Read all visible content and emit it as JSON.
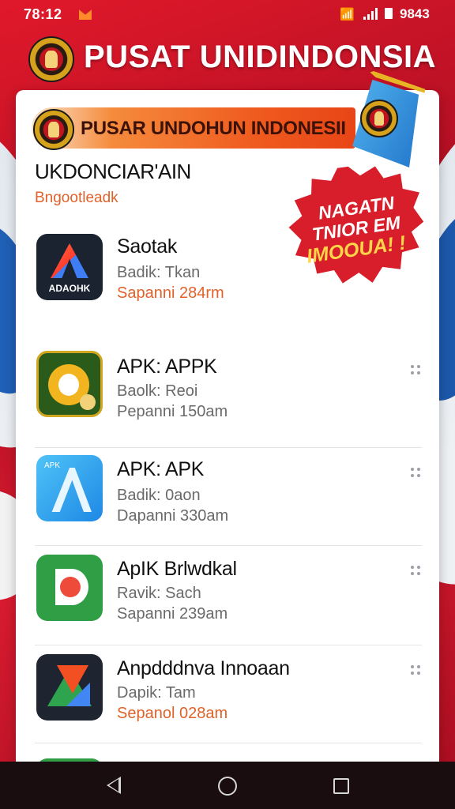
{
  "status_bar": {
    "time": "78:12",
    "battery_text": "9843",
    "icons": [
      "notification-icon",
      "wifi-icon",
      "signal-icon",
      "battery-icon"
    ]
  },
  "header": {
    "title": "PUSAT UNIDINDONSIA",
    "logo_icon": "garuda-emblem"
  },
  "banner": {
    "text": "PUSAR UNDOHUN INDONESII"
  },
  "section": {
    "title": "UKDONCIAR'AIN",
    "subtitle": "Bngootleadk"
  },
  "sticker": {
    "line1": "NAGATN",
    "line2": "TNIOR EM",
    "line3": "IMOOUA! !"
  },
  "apps": [
    {
      "name": "Saotak",
      "line1": "Badik: Tkan",
      "line2": "Sapanni 284rm",
      "icon": "dark-a-app-icon",
      "icon_label": "ADAOHK"
    },
    {
      "name": "APK: APPK",
      "line1": "Baolk: Reoi",
      "line2": "Pepanni 150am",
      "icon": "green-ring-app-icon"
    },
    {
      "name": "APK: APK",
      "line1": "Badik: 0aon",
      "line2": "Dapanni 330am",
      "icon": "blue-a-app-icon",
      "icon_label": "APK"
    },
    {
      "name": "ApIK Brlwdkal",
      "line1": "Ravik: Sach",
      "line2": "Sapanni 239am",
      "icon": "green-v-app-icon"
    },
    {
      "name": "Anpdddnva Innoaan",
      "line1": "Dapik: Tam",
      "line2": "Sepanol 028am",
      "icon": "triangle-app-icon"
    }
  ],
  "colors": {
    "primary_red": "#c8102e",
    "accent_orange": "#e0622a",
    "nav_bg": "#1a0d10"
  },
  "navbar": {
    "buttons": [
      "back-icon",
      "home-icon",
      "recents-icon"
    ]
  }
}
